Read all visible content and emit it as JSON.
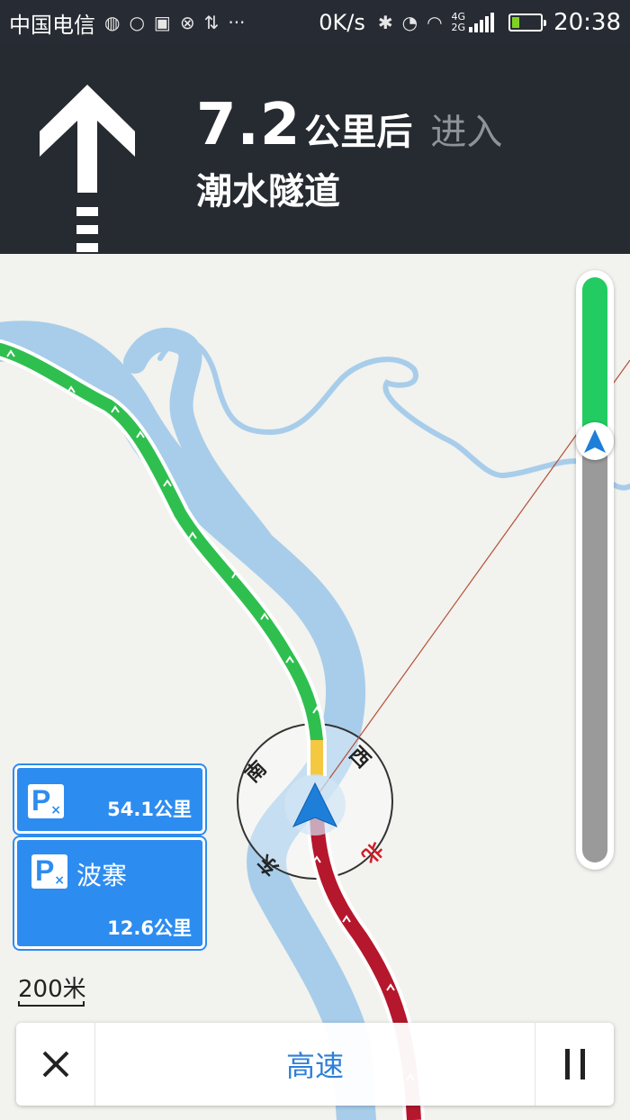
{
  "status_bar": {
    "carrier": "中国电信",
    "net_speed": "0K/s",
    "network_types": [
      "4G",
      "2G"
    ],
    "time": "20:38",
    "icons": [
      "weather-icon",
      "message-icon",
      "sim-icon",
      "sync-icon",
      "data-icon",
      "more-icon",
      "bluetooth-icon",
      "alarm-icon",
      "wifi-icon",
      "signal-icon",
      "battery-icon"
    ],
    "battery_level": 0.25
  },
  "navigation": {
    "turn_icon": "straight-arrow-icon",
    "distance_value": "7.2",
    "distance_unit": "公里后",
    "action": "进入",
    "road_name": "潮水隧道"
  },
  "compass": {
    "north": "北",
    "south": "南",
    "east": "东",
    "west": "西"
  },
  "route_progress": {
    "completed_fraction": 0.28,
    "colors": {
      "completed": "#22cc63",
      "remaining": "#9a9a9a"
    }
  },
  "parking": [
    {
      "icon": "parking-icon",
      "name": "",
      "distance": "54.1公里"
    },
    {
      "icon": "parking-icon",
      "name": "波寨",
      "distance": "12.6公里"
    }
  ],
  "scale": "200米",
  "bottom_bar": {
    "close_icon": "close-icon",
    "route_preference": "高速",
    "pause_icon": "pause-icon"
  },
  "colors": {
    "banner_bg": "#262a31",
    "route_clear": "#2fbf4f",
    "route_slow": "#f5c842",
    "route_congested": "#b5172c",
    "water": "#a7cdea",
    "accent": "#2d8cf0"
  }
}
